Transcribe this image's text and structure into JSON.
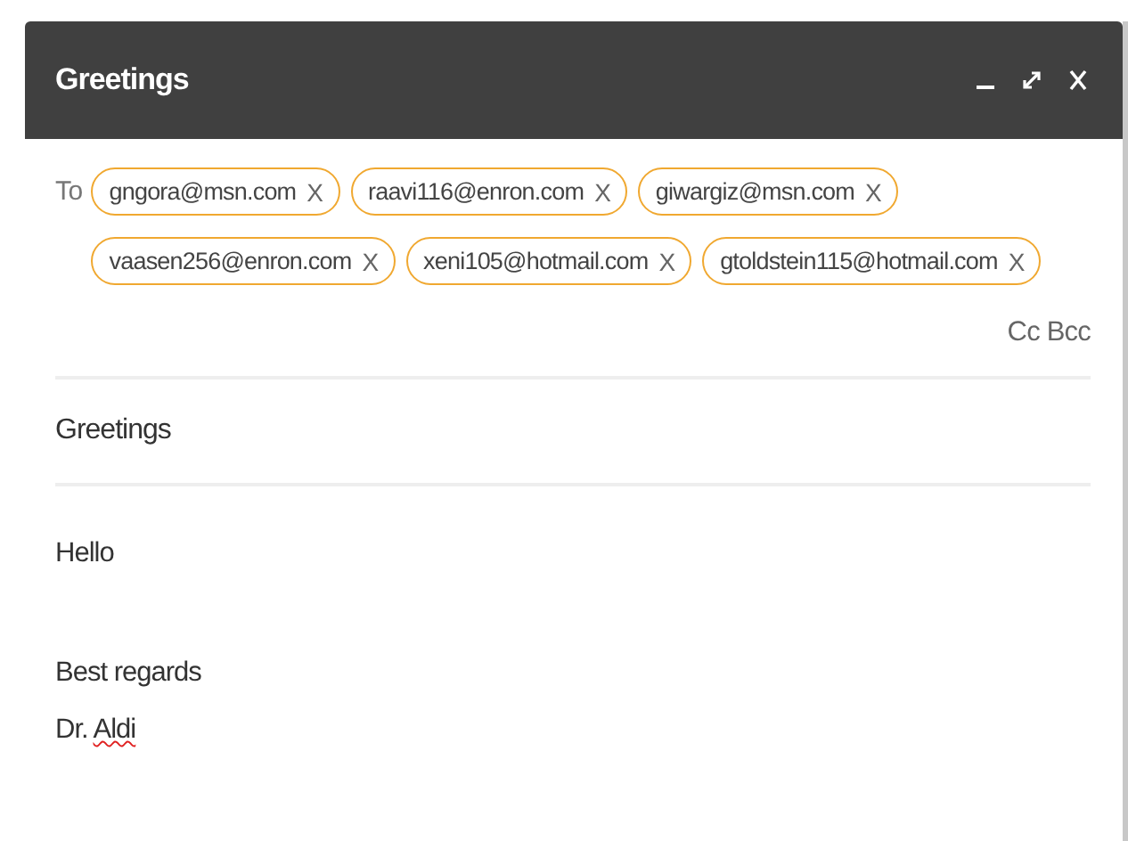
{
  "window": {
    "title": "Greetings",
    "controls": [
      {
        "kind": "minimize"
      },
      {
        "kind": "expand"
      },
      {
        "kind": "close"
      }
    ]
  },
  "to": {
    "label": "To",
    "recipients": [
      {
        "address": "gngora@msn.com",
        "remove": "X"
      },
      {
        "address": "raavi116@enron.com",
        "remove": "X"
      },
      {
        "address": "giwargiz@msn.com",
        "remove": "X"
      },
      {
        "address": "vaasen256@enron.com",
        "remove": "X"
      },
      {
        "address": "xeni105@hotmail.com",
        "remove": "X"
      },
      {
        "address": "gtoldstein115@hotmail.com",
        "remove": "X"
      }
    ]
  },
  "cc_bcc": "Cc Bcc",
  "subject": "Greetings",
  "body": [
    {
      "lines": [
        {
          "segments": [
            {
              "text": "Hello",
              "misspelled": false
            }
          ]
        }
      ]
    },
    {
      "lines": [
        {
          "segments": [
            {
              "text": "Best regards",
              "misspelled": false
            }
          ]
        },
        {
          "segments": [
            {
              "text": "Dr. ",
              "misspelled": false
            },
            {
              "text": "Aldi",
              "misspelled": true
            }
          ]
        }
      ]
    }
  ]
}
